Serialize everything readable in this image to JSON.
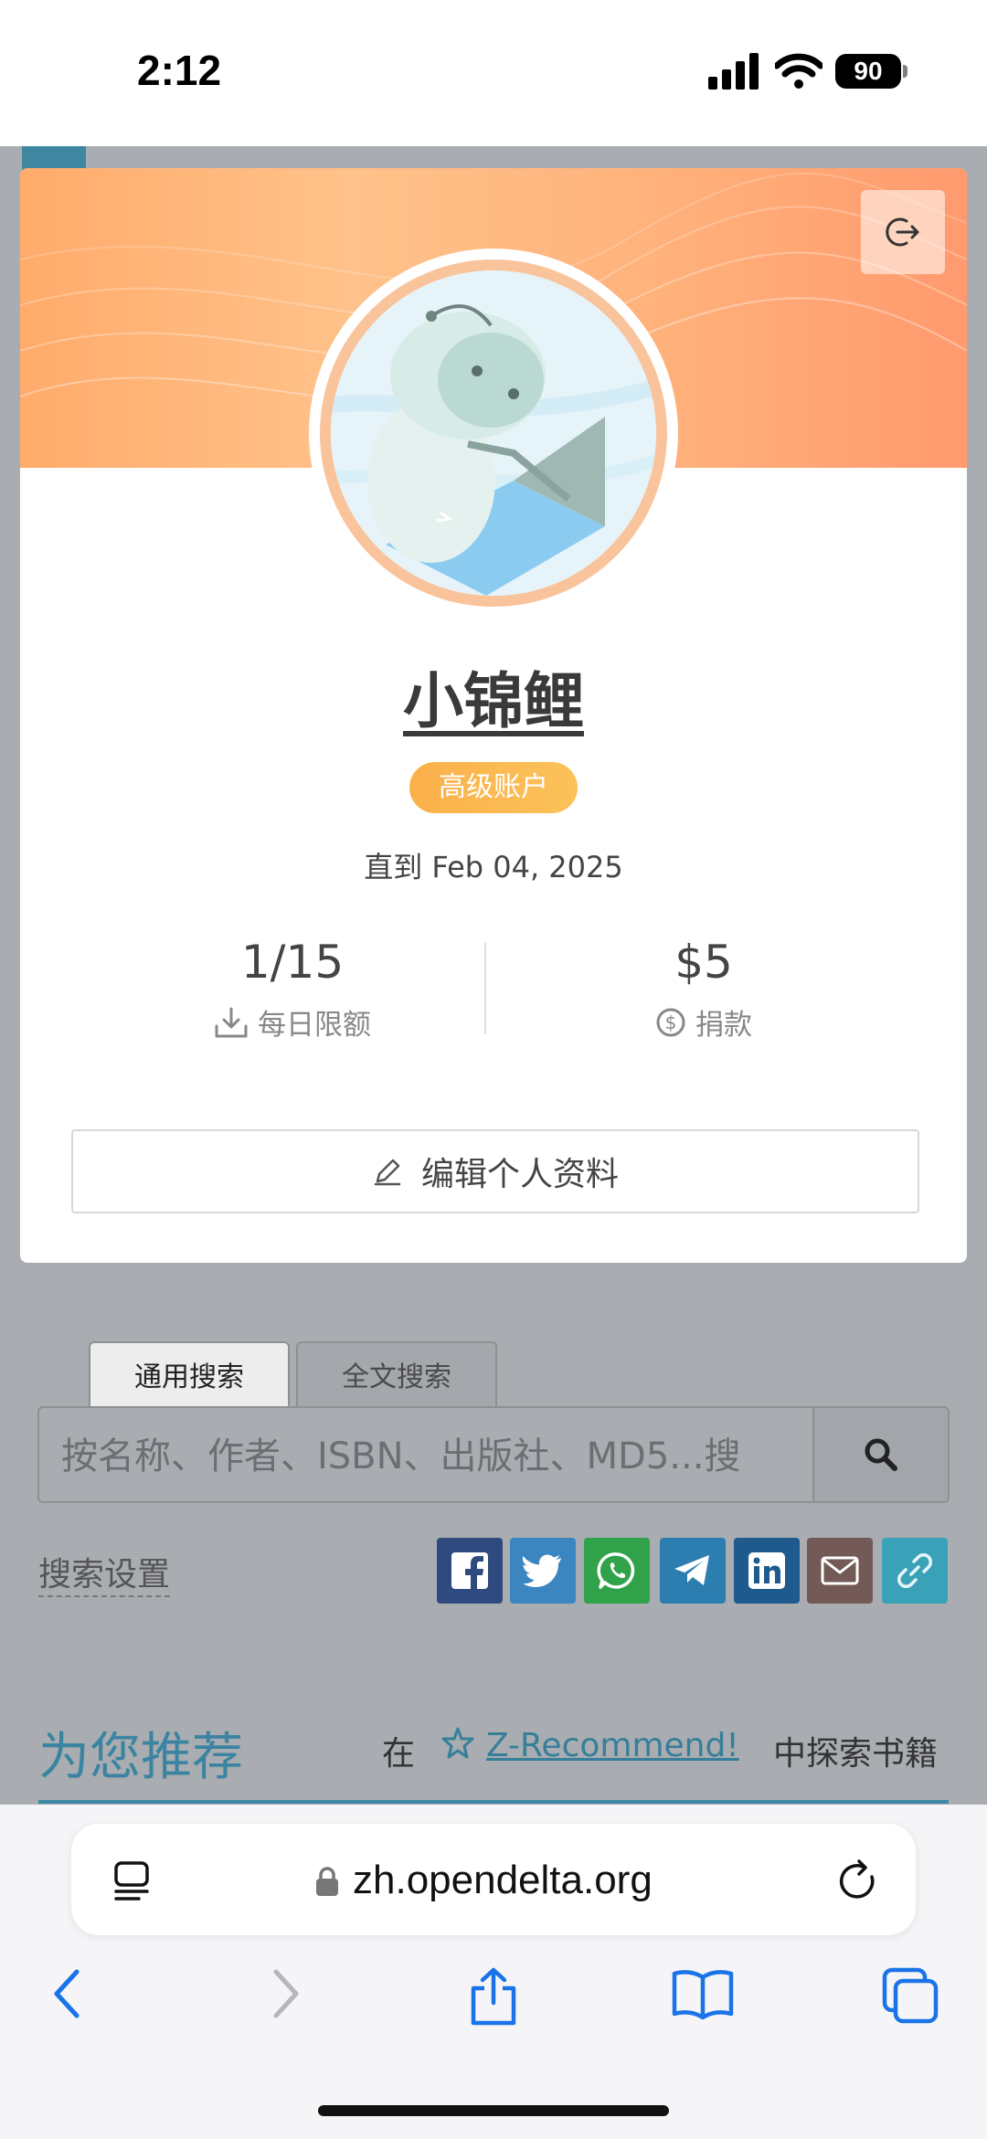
{
  "status_bar": {
    "time": "2:12",
    "battery": "90"
  },
  "profile": {
    "username": "小锦鲤",
    "badge": "高级账户",
    "until": "直到 Feb 04, 2025",
    "stats": [
      {
        "value": "1/15",
        "label": "每日限额",
        "icon": "download-icon"
      },
      {
        "value": "$5",
        "label": "捐款",
        "icon": "dollar-circle-icon"
      }
    ],
    "edit_label": "编辑个人资料"
  },
  "search": {
    "tabs": [
      {
        "label": "通用搜索",
        "active": true
      },
      {
        "label": "全文搜索",
        "active": false
      }
    ],
    "placeholder": "按名称、作者、ISBN、出版社、MD5...搜",
    "settings_label": "搜索设置",
    "share_icons": [
      "facebook-icon",
      "twitter-icon",
      "whatsapp-icon",
      "telegram-icon",
      "linkedin-icon",
      "mail-icon",
      "link-icon"
    ]
  },
  "recommend": {
    "title": "为您推荐",
    "prefix": "在",
    "link": "Z-Recommend!",
    "suffix": "中探索书籍"
  },
  "browser": {
    "url": "zh.opendelta.org"
  },
  "colors": {
    "accent": "#3a84a2",
    "badge": "#fbb04a",
    "banner": "#ffb07a",
    "ios_blue": "#1a73e8"
  }
}
